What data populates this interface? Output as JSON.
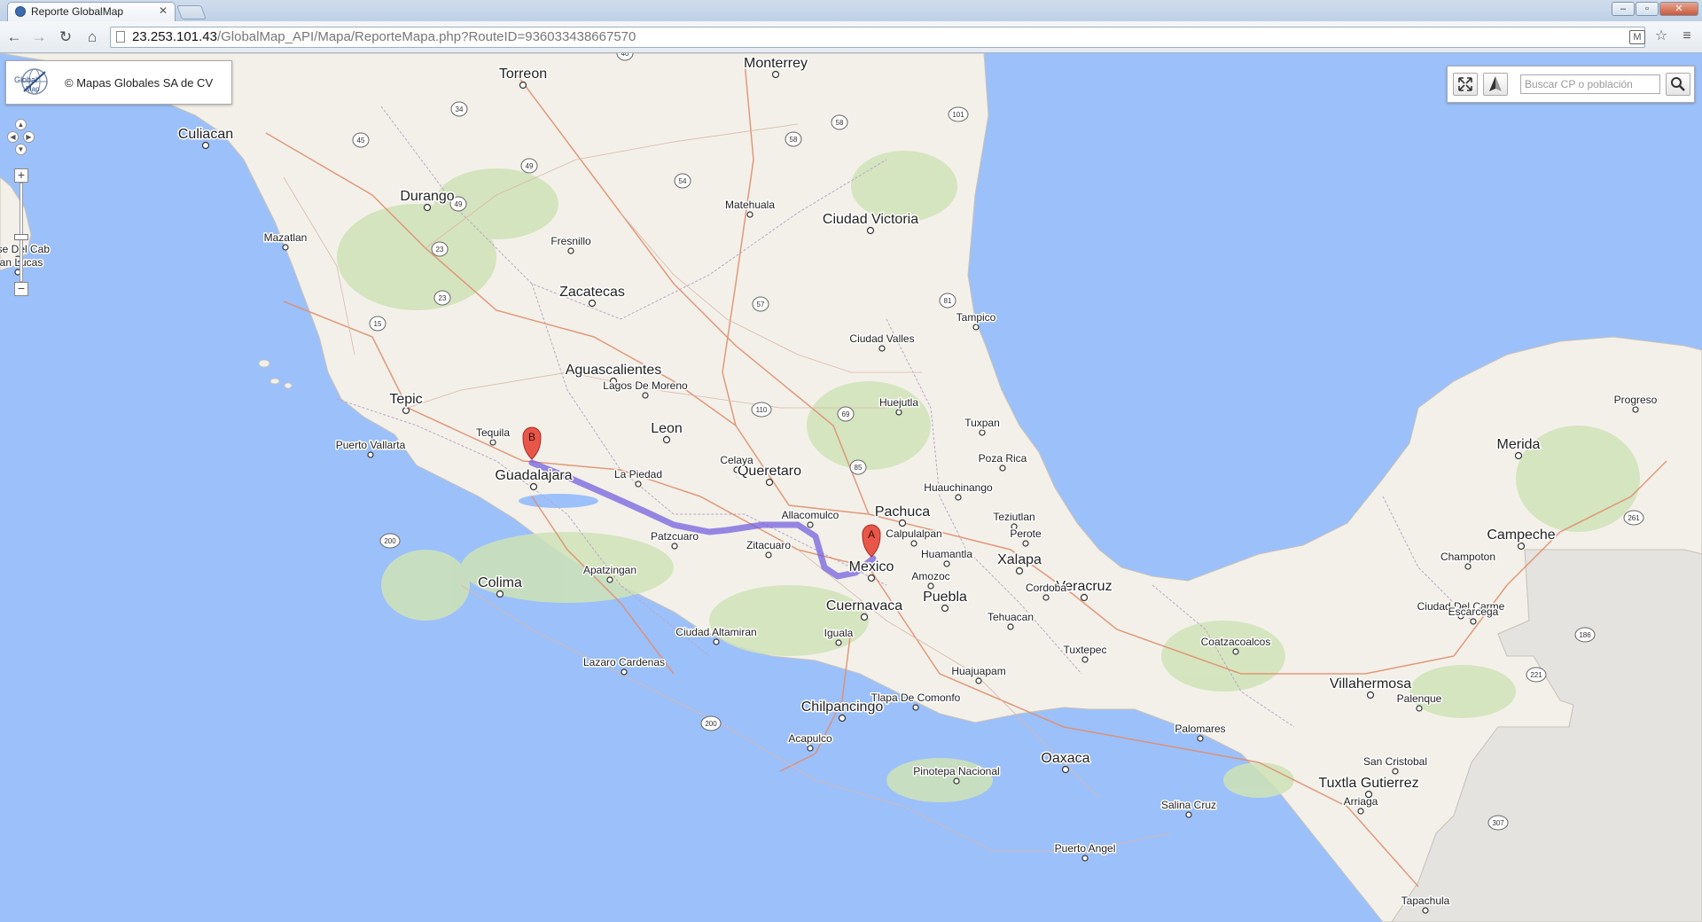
{
  "browser": {
    "tab_title": "Reporte GlobalMap",
    "url_host": "23.253.101.43",
    "url_path": "/GlobalMap_API/Mapa/ReporteMapa.php?RouteID=936033438667570",
    "ext_label": "M"
  },
  "map": {
    "copyright": "© Mapas Globales SA de CV",
    "logo_text_1": "Global",
    "logo_text_2": "Map",
    "search_placeholder": "Buscar CP o población",
    "marker_start": "A",
    "marker_end": "B",
    "colors": {
      "water": "#9cc0f9",
      "land": "#f3f0e9",
      "neighbor": "#e4e3e0",
      "route": "#6b57e0",
      "marker": "#e8564a"
    },
    "major_cities": [
      {
        "name": "Torreon"
      },
      {
        "name": "Monterrey"
      },
      {
        "name": "Culiacan"
      },
      {
        "name": "Durango"
      },
      {
        "name": "Ciudad Victoria"
      },
      {
        "name": "Zacatecas"
      },
      {
        "name": "Aguascalientes"
      },
      {
        "name": "Tepic"
      },
      {
        "name": "Leon"
      },
      {
        "name": "Guadalajara"
      },
      {
        "name": "Queretaro"
      },
      {
        "name": "Pachuca"
      },
      {
        "name": "Mexico"
      },
      {
        "name": "Xalapa"
      },
      {
        "name": "Veracruz"
      },
      {
        "name": "Puebla"
      },
      {
        "name": "Cuernavaca"
      },
      {
        "name": "Colima"
      },
      {
        "name": "Chilpancingo"
      },
      {
        "name": "Oaxaca"
      },
      {
        "name": "Tuxtla Gutierrez"
      },
      {
        "name": "Villahermosa"
      },
      {
        "name": "Campeche"
      },
      {
        "name": "Merida"
      }
    ],
    "minor_cities": [
      {
        "name": "Matehuala"
      },
      {
        "name": "Fresnillo"
      },
      {
        "name": "Mazatlan"
      },
      {
        "name": "Jose Del Cab"
      },
      {
        "name": "San Lucas"
      },
      {
        "name": "Ciudad Valles"
      },
      {
        "name": "Tampico"
      },
      {
        "name": "Lagos De Moreno"
      },
      {
        "name": "Tequila"
      },
      {
        "name": "Puerto Vallarta"
      },
      {
        "name": "La Piedad"
      },
      {
        "name": "Celaya"
      },
      {
        "name": "Huejutla"
      },
      {
        "name": "Tuxpan"
      },
      {
        "name": "Poza Rica"
      },
      {
        "name": "Huauchinango"
      },
      {
        "name": "Teziutlan"
      },
      {
        "name": "Perote"
      },
      {
        "name": "Allacomulco"
      },
      {
        "name": "Calpulalpan"
      },
      {
        "name": "Patzcuaro"
      },
      {
        "name": "Zitacuaro"
      },
      {
        "name": "Huamantla"
      },
      {
        "name": "Amozoc"
      },
      {
        "name": "Cordoba"
      },
      {
        "name": "Apatzingan"
      },
      {
        "name": "Tehuacan"
      },
      {
        "name": "Ciudad Altamiran"
      },
      {
        "name": "Iguala"
      },
      {
        "name": "Lazaro Cardenas"
      },
      {
        "name": "Tuxtepec"
      },
      {
        "name": "Coatzacoalcos"
      },
      {
        "name": "Huajuapam"
      },
      {
        "name": "Tlapa De Comonfo"
      },
      {
        "name": "Acapulco"
      },
      {
        "name": "Palomares"
      },
      {
        "name": "Pinotepa Nacional"
      },
      {
        "name": "Salina Cruz"
      },
      {
        "name": "Puerto Angel"
      },
      {
        "name": "Arriaga"
      },
      {
        "name": "San Cristobal"
      },
      {
        "name": "Palenque"
      },
      {
        "name": "Ciudad Del Carme"
      },
      {
        "name": "Escarcega"
      },
      {
        "name": "Champoton"
      },
      {
        "name": "Progreso"
      },
      {
        "name": "Tapachula"
      }
    ],
    "highway_shields": [
      {
        "label": "34"
      },
      {
        "label": "40"
      },
      {
        "label": "49"
      },
      {
        "label": "45"
      },
      {
        "label": "49"
      },
      {
        "label": "54"
      },
      {
        "label": "58"
      },
      {
        "label": "58"
      },
      {
        "label": "101"
      },
      {
        "label": "23"
      },
      {
        "label": "23"
      },
      {
        "label": "15"
      },
      {
        "label": "57"
      },
      {
        "label": "81"
      },
      {
        "label": "110"
      },
      {
        "label": "69"
      },
      {
        "label": "85"
      },
      {
        "label": "200"
      },
      {
        "label": "200"
      },
      {
        "label": "261"
      },
      {
        "label": "186"
      },
      {
        "label": "221"
      },
      {
        "label": "307"
      }
    ]
  }
}
